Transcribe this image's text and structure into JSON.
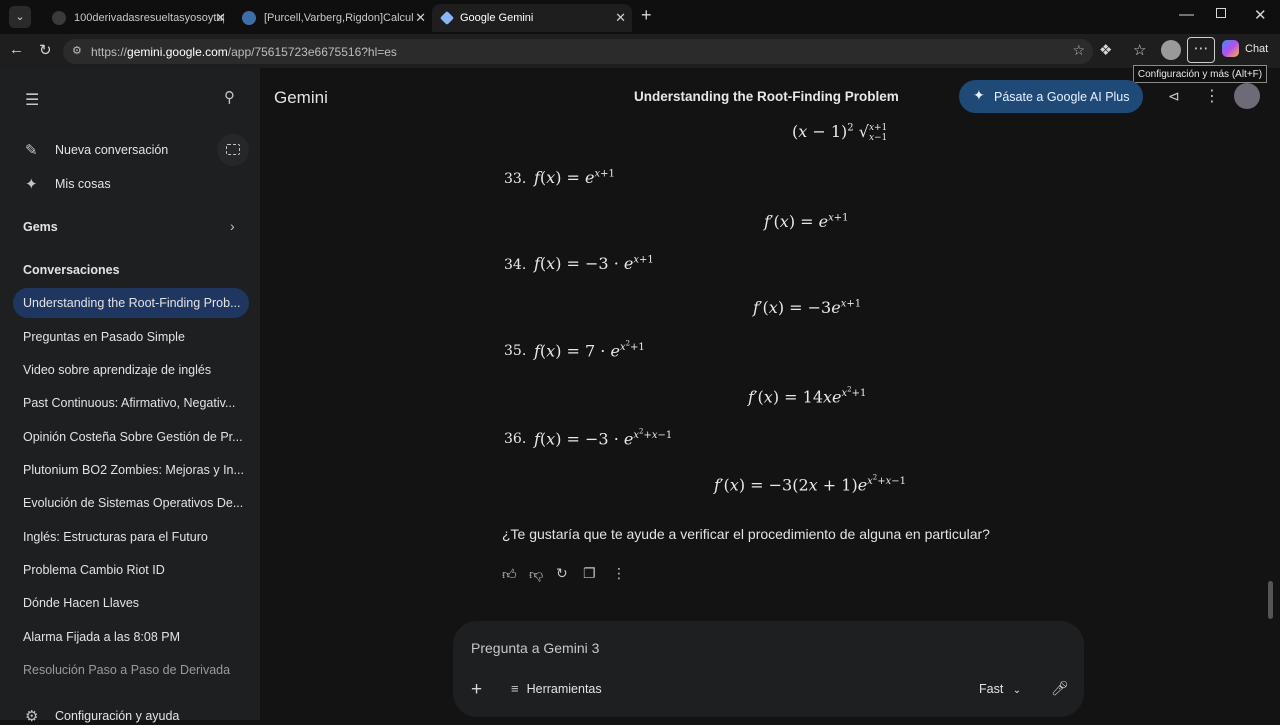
{
  "tabs": [
    {
      "title": "100derivadasresueltasyosoytupro",
      "active": false,
      "fav": "#3a3a3a"
    },
    {
      "title": "[Purcell,Varberg,Rigdon]Calculo.p",
      "active": false,
      "fav": "#3d6fa6"
    },
    {
      "title": "Google Gemini",
      "active": true,
      "fav": "#8ab4f8"
    }
  ],
  "address": {
    "prefix": "https://",
    "host": "gemini.google.com",
    "path": "/app/75615723e6675516?hl=es"
  },
  "chrome": {
    "chat_label": "Chat",
    "tooltip": "Configuración y más (Alt+F)"
  },
  "sidebar": {
    "new_chat": "Nueva conversación",
    "my_stuff": "Mis cosas",
    "gems": "Gems",
    "conversations_header": "Conversaciones",
    "conversations": [
      "Understanding the Root-Finding Prob...",
      "Preguntas en Pasado Simple",
      "Video sobre aprendizaje de inglés",
      "Past Continuous: Afirmativo, Negativ...",
      "Opinión Costeña Sobre Gestión de Pr...",
      "Plutonium BO2 Zombies: Mejoras y In...",
      "Evolución de Sistemas Operativos De...",
      "Inglés: Estructuras para el Futuro",
      "Problema Cambio Riot ID",
      "Dónde Hacen Llaves",
      "Alarma Fijada a las 8:08 PM",
      "Resolución Paso a Paso de Derivada"
    ],
    "settings": "Configuración y ayuda"
  },
  "header": {
    "brand": "Gemini",
    "title": "Understanding the Root-Finding Problem",
    "upgrade": "Pásate a Google AI Plus"
  },
  "content": {
    "n33": "33.",
    "n34": "34.",
    "n35": "35.",
    "n36": "36.",
    "question": "¿Te gustaría que te ayude a verificar el procedimiento de alguna en particular?"
  },
  "composer": {
    "placeholder": "Pregunta a Gemini 3",
    "tools": "Herramientas",
    "mode": "Fast"
  }
}
